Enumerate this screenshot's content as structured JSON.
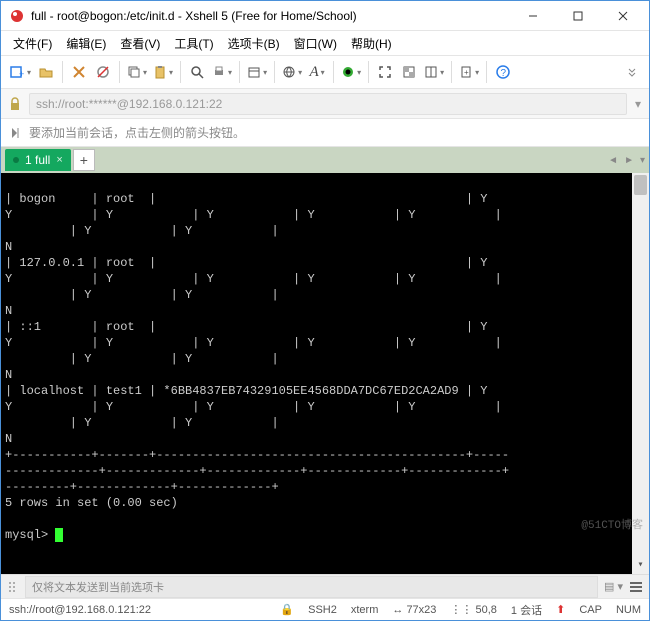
{
  "window": {
    "title": "full - root@bogon:/etc/init.d - Xshell 5 (Free for Home/School)"
  },
  "menu": {
    "file": "文件(F)",
    "edit": "编辑(E)",
    "view": "查看(V)",
    "tools": "工具(T)",
    "tabs": "选项卡(B)",
    "window": "窗口(W)",
    "help": "帮助(H)"
  },
  "address": {
    "value": "ssh://root:******@192.168.0.121:22"
  },
  "hint": {
    "text": "要添加当前会话，点击左侧的箭头按钮。"
  },
  "tab": {
    "label": "1 full"
  },
  "terminal": {
    "content": "| bogon     | root  |                                           | Y\nY           | Y           | Y           | Y           | Y           |\n         | Y           | Y           |\nN\n| 127.0.0.1 | root  |                                           | Y\nY           | Y           | Y           | Y           | Y           |\n         | Y           | Y           |\nN\n| ::1       | root  |                                           | Y\nY           | Y           | Y           | Y           | Y           |\n         | Y           | Y           |\nN\n| localhost | test1 | *6BB4837EB74329105EE4568DDA7DC67ED2CA2AD9 | Y\nY           | Y           | Y           | Y           | Y           |\n         | Y           | Y           |\nN\n+-----------+-------+-------------------------------------------+-----\n-------------+-------------+-------------+-------------+-------------+\n---------+-------------+-------------+\n5 rows in set (0.00 sec)\n\nmysql> "
  },
  "bottombar": {
    "placeholder": "仅将文本发送到当前选项卡"
  },
  "status": {
    "conn": "ssh://root@192.168.0.121:22",
    "ssh": "SSH2",
    "term": "xterm",
    "size": "77x23",
    "cursor": "50,8",
    "sessions": "1 会话",
    "caps": "CAP",
    "num": "NUM"
  },
  "watermark": "@51CTO博客"
}
